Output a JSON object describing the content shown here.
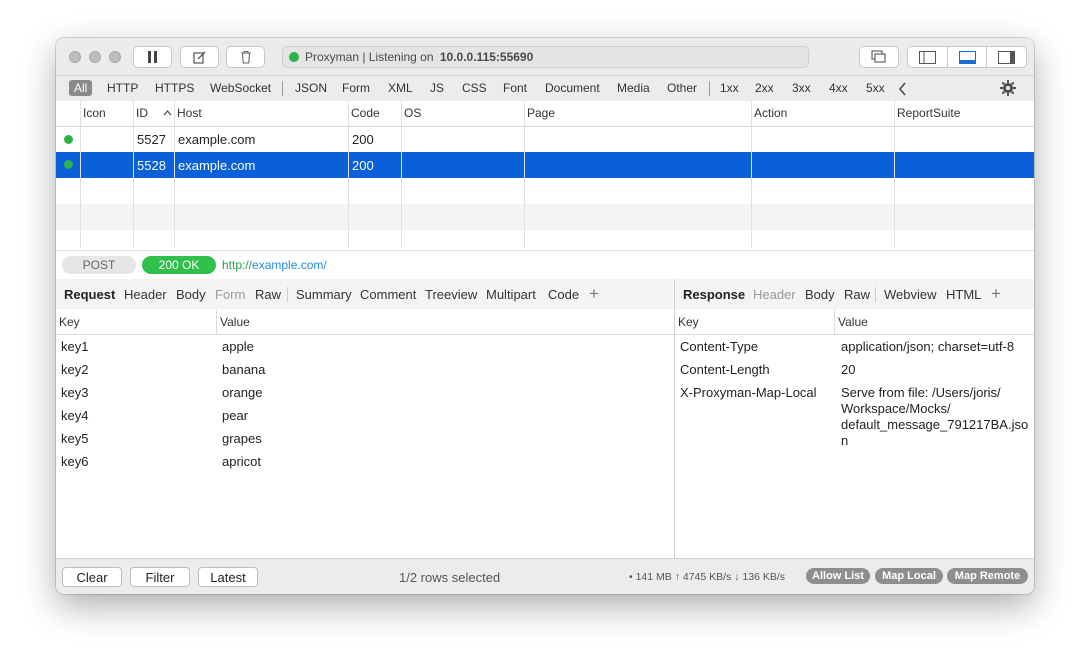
{
  "titlebar": {
    "status_prefix": "Proxyman | Listening on ",
    "status_address": "10.0.0.115:55690"
  },
  "filters": {
    "items": [
      "All",
      "HTTP",
      "HTTPS",
      "WebSocket",
      "JSON",
      "Form",
      "XML",
      "JS",
      "CSS",
      "Font",
      "Document",
      "Media",
      "Other",
      "1xx",
      "2xx",
      "3xx",
      "4xx",
      "5xx"
    ],
    "active": "All"
  },
  "table": {
    "columns": [
      "Icon",
      "ID",
      "Host",
      "Code",
      "OS",
      "Page",
      "Action",
      "ReportSuite"
    ],
    "rows": [
      {
        "id": "5527",
        "host": "example.com",
        "code": "200"
      },
      {
        "id": "5528",
        "host": "example.com",
        "code": "200"
      }
    ]
  },
  "urlbar": {
    "method": "POST",
    "status": "200 OK",
    "url_scheme": "http://",
    "url_host": "example.com/"
  },
  "request_tabs": {
    "title": "Request",
    "tabs": [
      "Header",
      "Body",
      "Form",
      "Raw",
      "Summary",
      "Comment",
      "Treeview",
      "Multipart",
      "Code"
    ],
    "plus": "+"
  },
  "response_tabs": {
    "title": "Response",
    "tabs": [
      "Header",
      "Body",
      "Raw",
      "Webview",
      "HTML"
    ],
    "plus": "+"
  },
  "request_kv": {
    "key_header": "Key",
    "value_header": "Value",
    "rows": [
      {
        "k": "key1",
        "v": "apple"
      },
      {
        "k": "key2",
        "v": "banana"
      },
      {
        "k": "key3",
        "v": "orange"
      },
      {
        "k": "key4",
        "v": "pear"
      },
      {
        "k": "key5",
        "v": "grapes"
      },
      {
        "k": "key6",
        "v": "apricot"
      }
    ]
  },
  "response_kv": {
    "key_header": "Key",
    "value_header": "Value",
    "rows": [
      {
        "k": "Content-Type",
        "v": [
          "application/json; charset=utf-8"
        ]
      },
      {
        "k": "Content-Length",
        "v": [
          "20"
        ]
      },
      {
        "k": "X-Proxyman-Map-Local",
        "v": [
          "Serve from file: /Users/joris/",
          "Workspace/Mocks/",
          "default_message_791217BA.jso",
          "n"
        ]
      }
    ]
  },
  "bottombar": {
    "clear": "Clear",
    "filter": "Filter",
    "latest": "Latest",
    "selection": "1/2 rows selected",
    "stats": "• 141 MB ↑ 4745 KB/s ↓ 136 KB/s",
    "allow_list": "Allow List",
    "map_local": "Map Local",
    "map_remote": "Map Remote"
  },
  "colors": {
    "selection": "#0a60d9",
    "status_green": "#2bb34a",
    "ok_pill": "#2fbf4a",
    "url_link": "#1f8ce0"
  }
}
